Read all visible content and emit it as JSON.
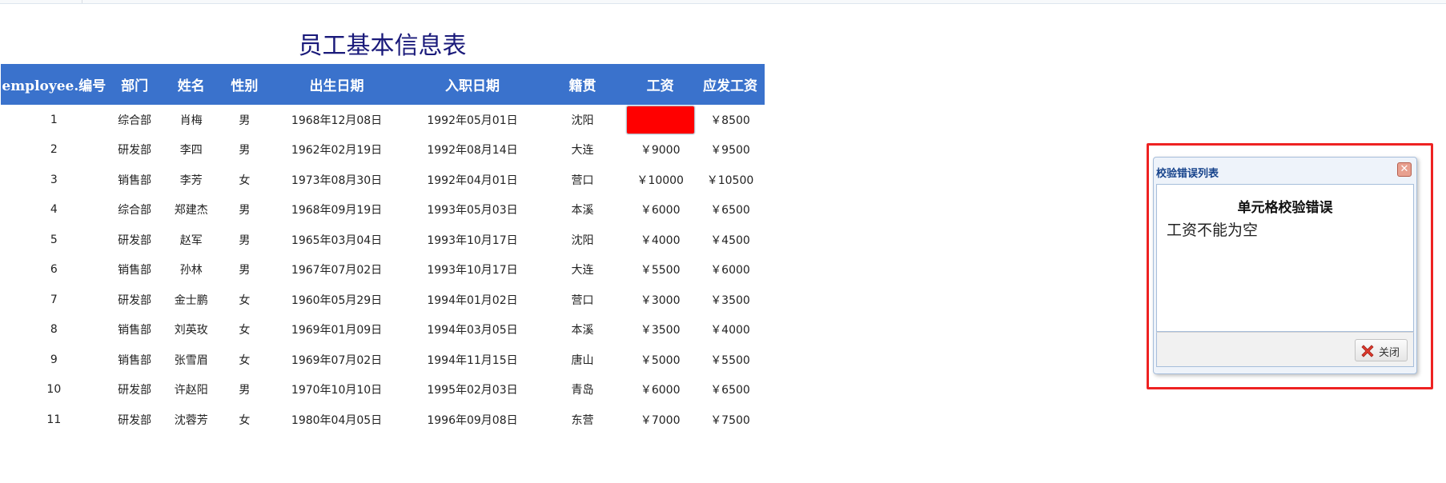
{
  "sheet": {
    "title": "员工基本信息表",
    "columns": [
      "employee.编号",
      "部门",
      "姓名",
      "性别",
      "出生日期",
      "入职日期",
      "籍贯",
      "工资",
      "应发工资"
    ],
    "rows": [
      [
        "1",
        "综合部",
        "肖梅",
        "男",
        "1968年12月08日",
        "1992年05月01日",
        "沈阳",
        "",
        "￥8500"
      ],
      [
        "2",
        "研发部",
        "李四",
        "男",
        "1962年02月19日",
        "1992年08月14日",
        "大连",
        "￥9000",
        "￥9500"
      ],
      [
        "3",
        "销售部",
        "李芳",
        "女",
        "1973年08月30日",
        "1992年04月01日",
        "营口",
        "￥10000",
        "￥10500"
      ],
      [
        "4",
        "综合部",
        "郑建杰",
        "男",
        "1968年09月19日",
        "1993年05月03日",
        "本溪",
        "￥6000",
        "￥6500"
      ],
      [
        "5",
        "研发部",
        "赵军",
        "男",
        "1965年03月04日",
        "1993年10月17日",
        "沈阳",
        "￥4000",
        "￥4500"
      ],
      [
        "6",
        "销售部",
        "孙林",
        "男",
        "1967年07月02日",
        "1993年10月17日",
        "大连",
        "￥5500",
        "￥6000"
      ],
      [
        "7",
        "研发部",
        "金士鹏",
        "女",
        "1960年05月29日",
        "1994年01月02日",
        "营口",
        "￥3000",
        "￥3500"
      ],
      [
        "8",
        "销售部",
        "刘英玫",
        "女",
        "1969年01月09日",
        "1994年03月05日",
        "本溪",
        "￥3500",
        "￥4000"
      ],
      [
        "9",
        "销售部",
        "张雪眉",
        "女",
        "1969年07月02日",
        "1994年11月15日",
        "唐山",
        "￥5000",
        "￥5500"
      ],
      [
        "10",
        "研发部",
        "许赵阳",
        "男",
        "1970年10月10日",
        "1995年02月03日",
        "青岛",
        "￥6000",
        "￥6500"
      ],
      [
        "11",
        "研发部",
        "沈蓉芳",
        "女",
        "1980年04月05日",
        "1996年09月08日",
        "东营",
        "￥7000",
        "￥7500"
      ]
    ],
    "error_cell": {
      "row": 0,
      "col": 7,
      "color": "#ff0000"
    },
    "header_color": "#3a72cc",
    "title_color": "#1a1a7a"
  },
  "dialog": {
    "title": "校验错误列表",
    "message_title": "单元格校验错误",
    "message": "工资不能为空",
    "close_label": "关闭",
    "close_icon": "close-icon",
    "highlight_color": "#ee2222"
  }
}
